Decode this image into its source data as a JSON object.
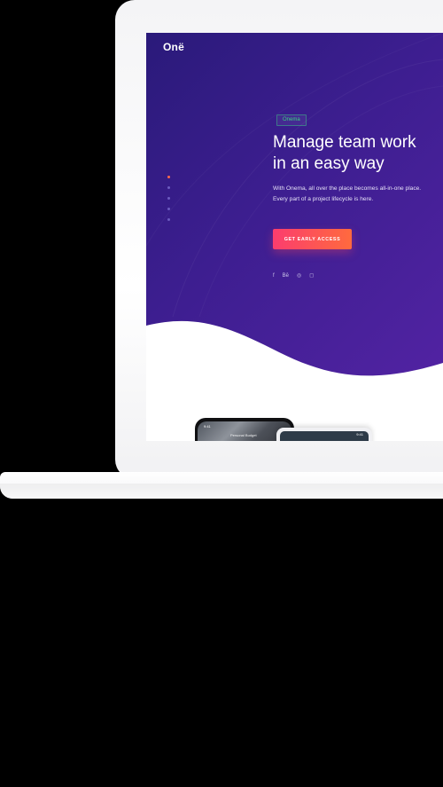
{
  "site": {
    "logo": "Onë",
    "badge": "Onema",
    "title_line1": "Manage team work",
    "title_line2": "in an easy way",
    "desc_line1": "With Onema, all over the place becomes all-in-one place.",
    "desc_line2": "Every part of a project lifecycle is here.",
    "cta_label": "GET EARLY ACCESS",
    "social": [
      "f",
      "Bē",
      "◎",
      "◻"
    ]
  },
  "phones": {
    "status_time": "9:41",
    "title": "Personal Budget"
  },
  "colors": {
    "hero_start": "#2a1a7a",
    "hero_end": "#5223a3",
    "cta_start": "#fb3d6e",
    "cta_end": "#ff6a3e",
    "badge_text": "#38d57f"
  }
}
